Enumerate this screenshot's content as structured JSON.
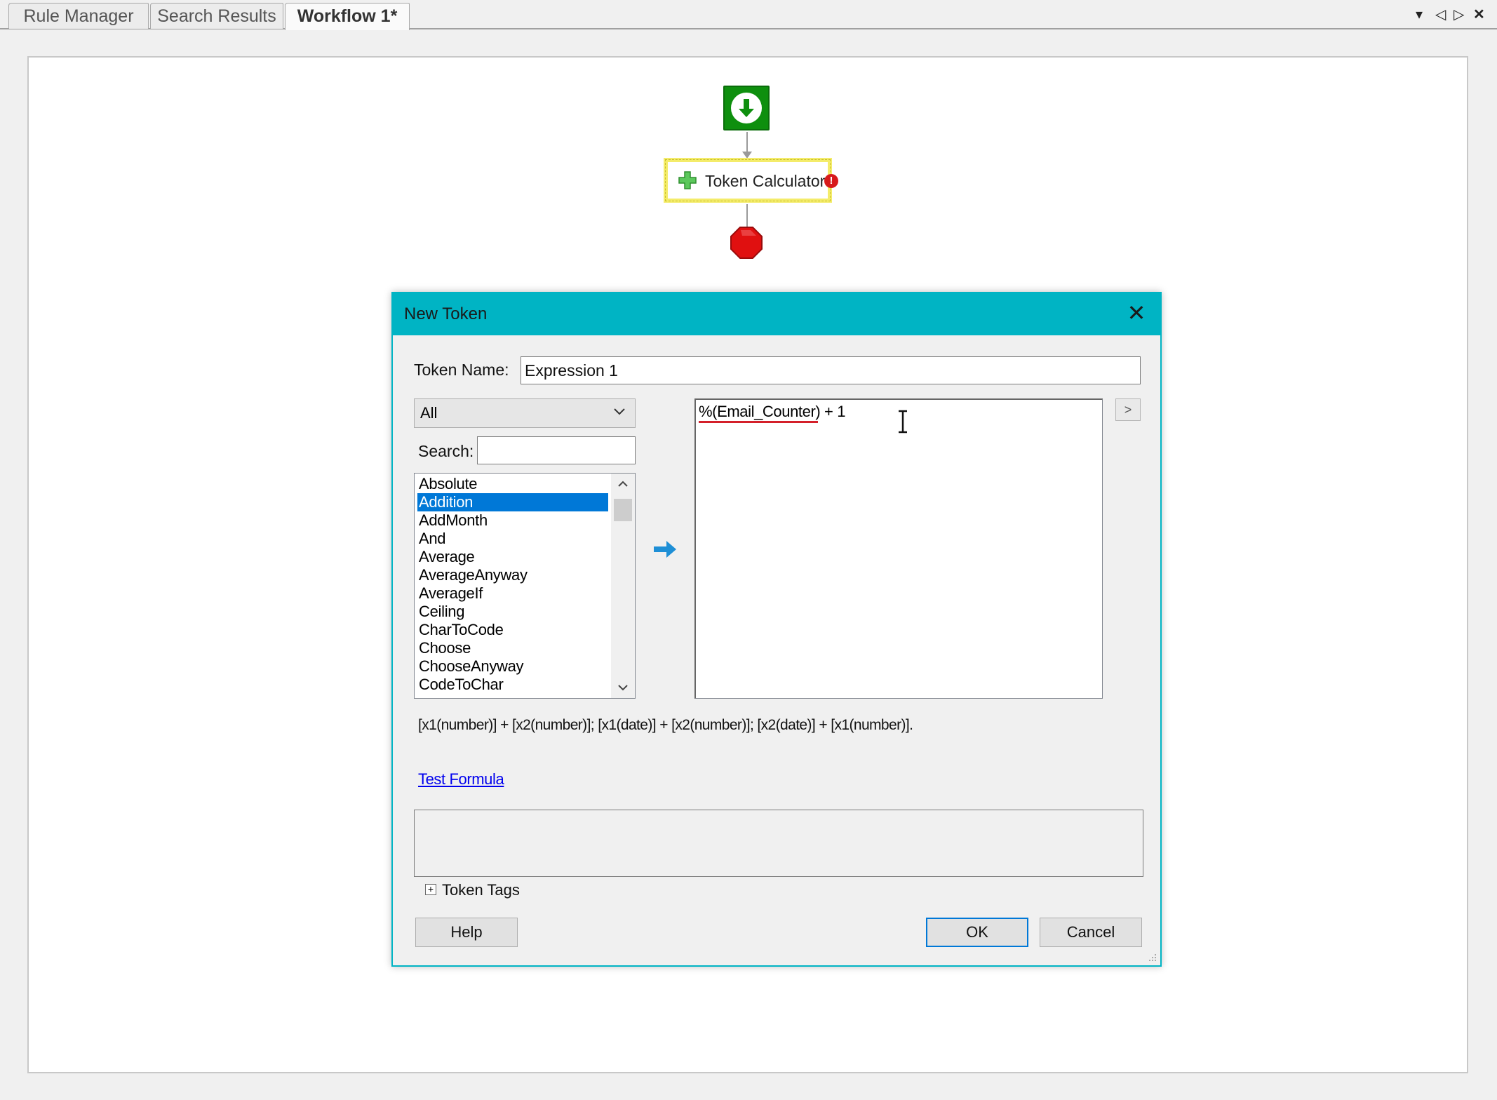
{
  "tabs": [
    {
      "label": "Rule Manager"
    },
    {
      "label": "Search Results"
    },
    {
      "label": "Workflow 1*"
    }
  ],
  "tab_controls": {
    "dropdown": "▾",
    "prev": "◁",
    "next": "▷",
    "close": "✕"
  },
  "workflow": {
    "calc_node_label": "Token Calculator",
    "error_badge": "!"
  },
  "dialog": {
    "title": "New Token",
    "close_glyph": "✕",
    "token_name_label": "Token Name:",
    "token_name_value": "Expression 1",
    "category_value": "All",
    "search_label": "Search:",
    "search_value": "",
    "functions": [
      "Absolute",
      "Addition",
      "AddMonth",
      "And",
      "Average",
      "AverageAnyway",
      "AverageIf",
      "Ceiling",
      "CharToCode",
      "Choose",
      "ChooseAnyway",
      "CodeToChar"
    ],
    "selected_function": "Addition",
    "expression_token": "%(Email_Counter)",
    "expression_rest": " + 1",
    "expand_label": ">",
    "syntax_hint": "[x1(number)] + [x2(number)]; [x1(date)] + [x2(number)]; [x2(date)] + [x1(number)].",
    "test_formula_link": "Test Formula",
    "result_text": "",
    "tags_label": "Token Tags",
    "tags_toggle": "+",
    "help_button": "Help",
    "ok_button": "OK",
    "cancel_button": "Cancel"
  },
  "colors": {
    "dialog_accent": "#00b4c4",
    "selection": "#0078d7",
    "start_node": "#0e8f0e",
    "stop_node": "#e01010",
    "error_badge": "#d71a1a",
    "link": "#0000ee"
  },
  "icons": {
    "start": "download-circle-icon",
    "calc": "plus-icon",
    "stop": "stop-octagon-icon",
    "insert": "arrow-right-icon",
    "cursor": "text-cursor-icon"
  }
}
